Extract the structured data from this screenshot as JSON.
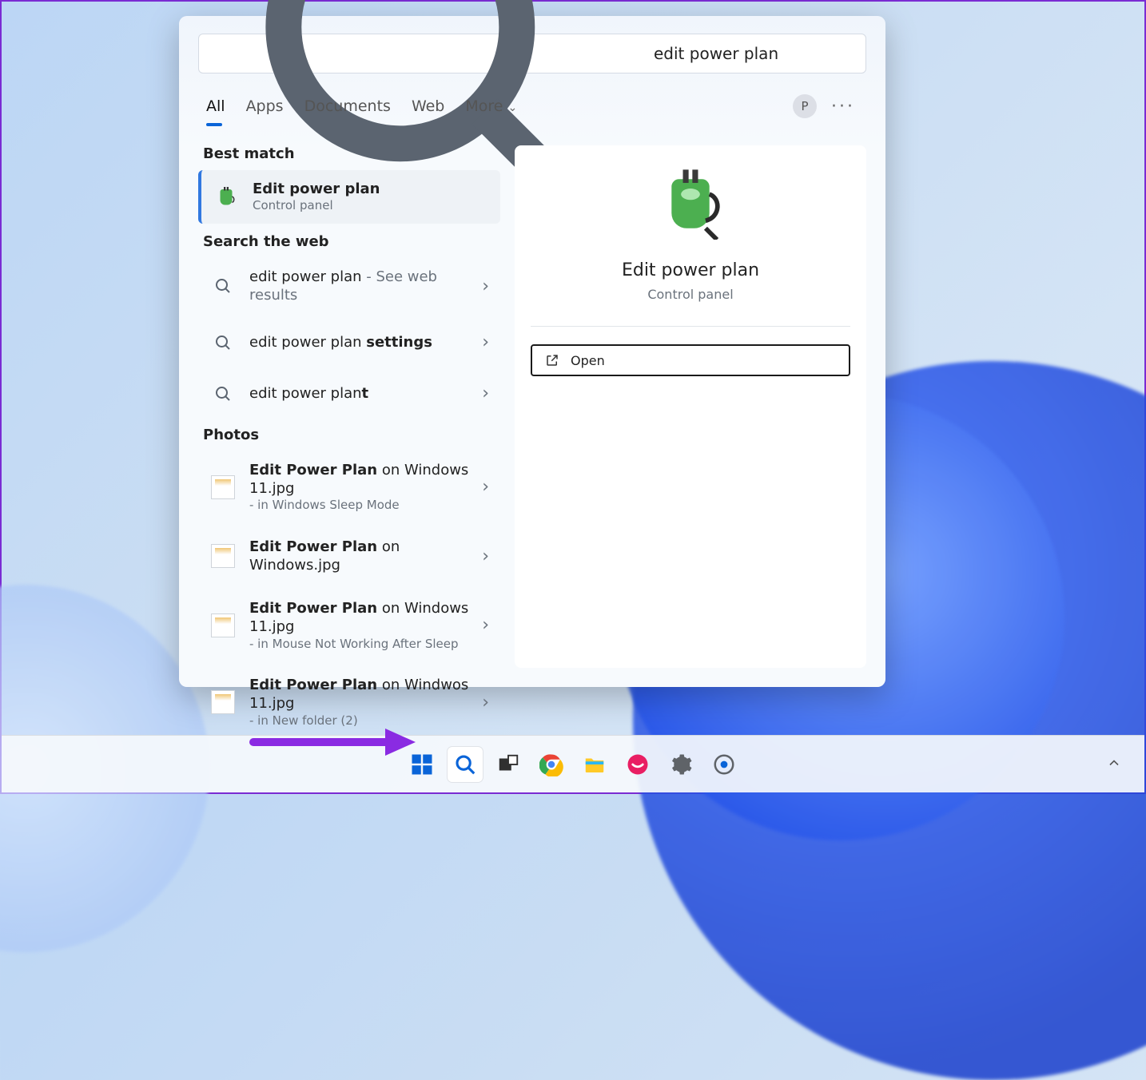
{
  "search": {
    "query": "edit power plan"
  },
  "tabs": {
    "all": "All",
    "apps": "Apps",
    "documents": "Documents",
    "web": "Web",
    "more": "More"
  },
  "avatar_initial": "P",
  "sections": {
    "best": "Best match",
    "web": "Search the web",
    "photos": "Photos"
  },
  "best_match": {
    "title": "Edit power plan",
    "subtitle": "Control panel"
  },
  "web_results": [
    {
      "prefix": "edit power plan",
      "suffix": " - See web results",
      "bold": ""
    },
    {
      "prefix": "edit power plan ",
      "suffix": "",
      "bold": "settings"
    },
    {
      "prefix": "edit power plan",
      "suffix": "",
      "bold": "t"
    }
  ],
  "photos": [
    {
      "bold": "Edit Power Plan",
      "rest": " on Windows 11.jpg",
      "sub": "- in Windows Sleep Mode"
    },
    {
      "bold": "Edit Power Plan",
      "rest": " on Windows.jpg",
      "sub": ""
    },
    {
      "bold": "Edit Power Plan",
      "rest": " on Windows 11.jpg",
      "sub": "- in Mouse Not Working After Sleep"
    },
    {
      "bold": "Edit Power Plan",
      "rest": " on Windwos 11.jpg",
      "sub": "- in New folder (2)"
    }
  ],
  "detail": {
    "title": "Edit power plan",
    "subtitle": "Control panel",
    "open": "Open"
  }
}
